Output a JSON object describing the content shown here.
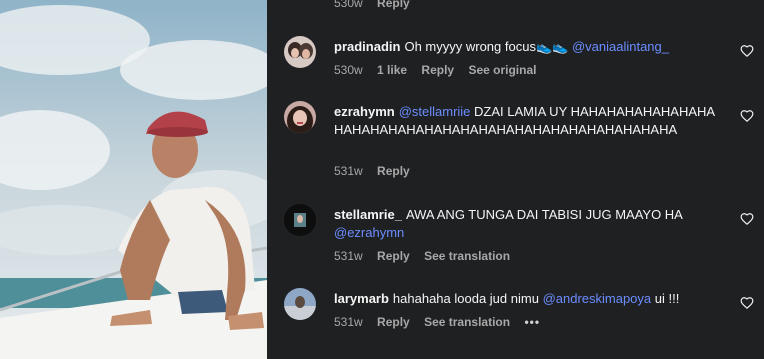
{
  "top_partial": {
    "time": "530w",
    "reply": "Reply"
  },
  "comments": [
    {
      "username": "pradinadin",
      "text": "Oh myyyy wrong focus",
      "emoji": "👟👟",
      "mention": "@vaniaalintang_",
      "time": "530w",
      "likes": "1 like",
      "reply": "Reply",
      "extra": "See original"
    },
    {
      "username": "ezrahymn",
      "mention": "@stellamriie",
      "text": "DZAI LAMIA UY HAHAHAHAHAHAHAHAHAHAHAHAHAHAHAHAHAHAHAHAHAHAHAHAHAHAHA",
      "time": "531w",
      "reply": "Reply"
    },
    {
      "username": "stellamrie_",
      "text": "AWA ANG TUNGA DAI TABISI JUG MAAYO HA",
      "mention": "@ezrahymn",
      "time": "531w",
      "reply": "Reply",
      "extra": "See translation"
    },
    {
      "username": "larymarb",
      "text": "hahahaha looda jud nimu",
      "mention": "@andreskimapoya",
      "text_after": "ui !!!",
      "time": "531w",
      "reply": "Reply",
      "extra": "See translation",
      "more": "•••"
    }
  ],
  "icons": {
    "like": "heart-outline-icon",
    "more": "more-horizontal-icon"
  },
  "colors": {
    "background": "#1f2022",
    "mention": "#6b8dff",
    "meta": "#a8a8a8"
  }
}
